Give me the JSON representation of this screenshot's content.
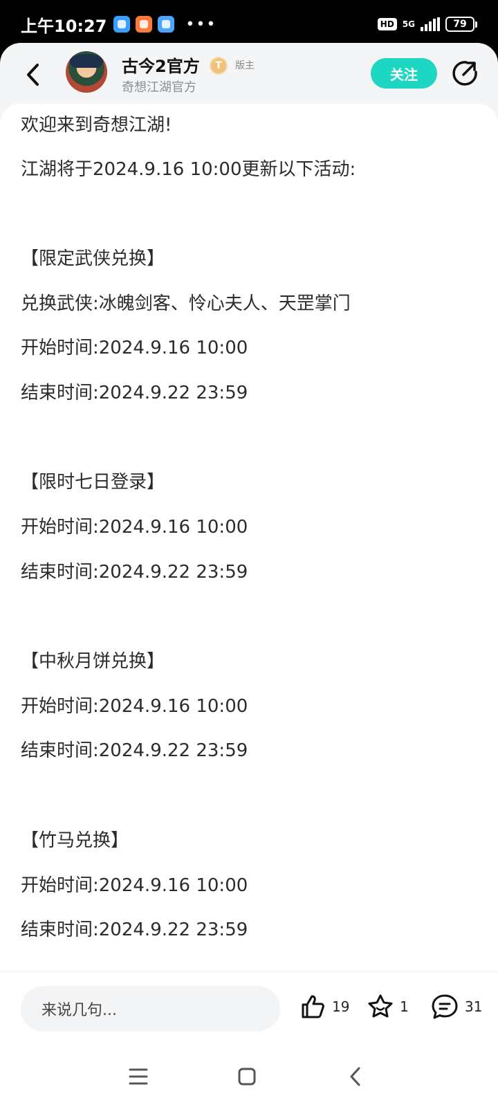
{
  "status_bar": {
    "time": "上午10:27",
    "network": "5G",
    "hd": "HD",
    "battery": "79"
  },
  "header": {
    "author_name": "古今2官方",
    "level_badge": "T",
    "role": "版主",
    "subtitle": "奇想江湖官方",
    "follow_label": "关注",
    "accent_color": "#1ed7c3"
  },
  "post": {
    "lines": [
      "欢迎来到奇想江湖!",
      "江湖将于2024.9.16 10:00更新以下活动:",
      "【限定武侠兑换】",
      "兑换武侠:冰魄剑客、怜心夫人、天罡掌门",
      "开始时间:2024.9.16 10:00",
      "结束时间:2024.9.22 23:59",
      "【限时七日登录】",
      "开始时间:2024.9.16 10:00",
      "结束时间:2024.9.22 23:59",
      "【中秋月饼兑换】",
      "开始时间:2024.9.16 10:00",
      "结束时间:2024.9.22 23:59",
      "【竹马兑换】",
      "开始时间:2024.9.16 10:00",
      "结束时间:2024.9.22 23:59"
    ]
  },
  "actions": {
    "comment_placeholder": "来说几句...",
    "likes": "19",
    "favorites": "1",
    "comments": "31"
  }
}
